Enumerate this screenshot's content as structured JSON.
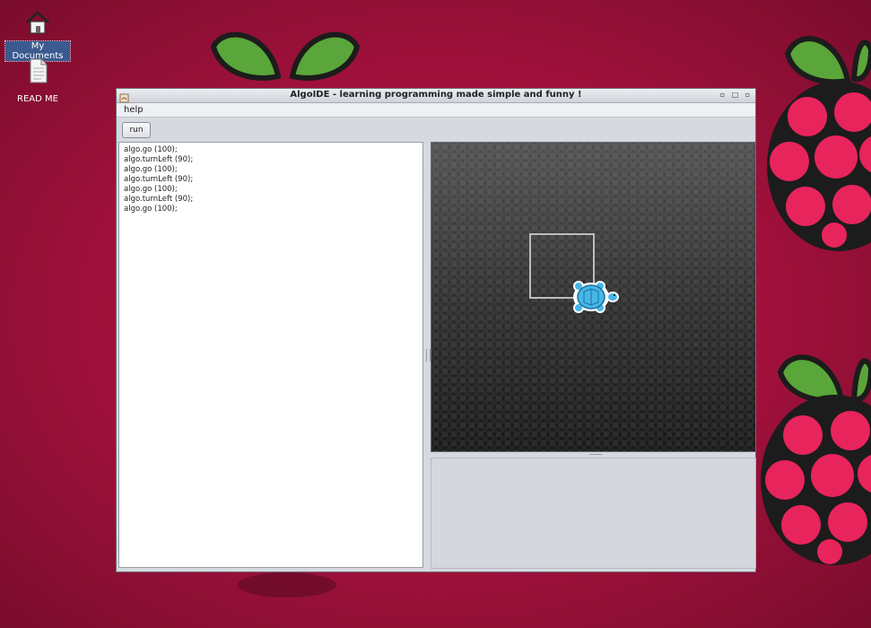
{
  "desktop": {
    "icons": [
      {
        "label": "My Documents",
        "icon": "home-icon",
        "selected": true
      },
      {
        "label": "READ ME",
        "icon": "document-icon",
        "selected": false
      }
    ],
    "background_color": "#b3123f",
    "wallpaper": "raspberry-logo"
  },
  "window": {
    "title": "AlgoIDE - learning programming made simple and funny !",
    "controls": [
      "minimize",
      "maximize",
      "close"
    ]
  },
  "menubar": {
    "items": [
      "help"
    ]
  },
  "toolbar": {
    "run_label": "run"
  },
  "editor": {
    "lines": [
      "algo.go (100);",
      "algo.turnLeft (90);",
      "algo.go (100);",
      "algo.turnLeft (90);",
      "algo.go (100);",
      "algo.turnLeft (90);",
      "algo.go (100);"
    ]
  },
  "canvas": {
    "background": "dark-dotted-gradient",
    "drawing": "square-path",
    "sprite": "turtle-icon",
    "stroke_color": "#bdbdbd",
    "turtle_color": "#45b7ea"
  }
}
